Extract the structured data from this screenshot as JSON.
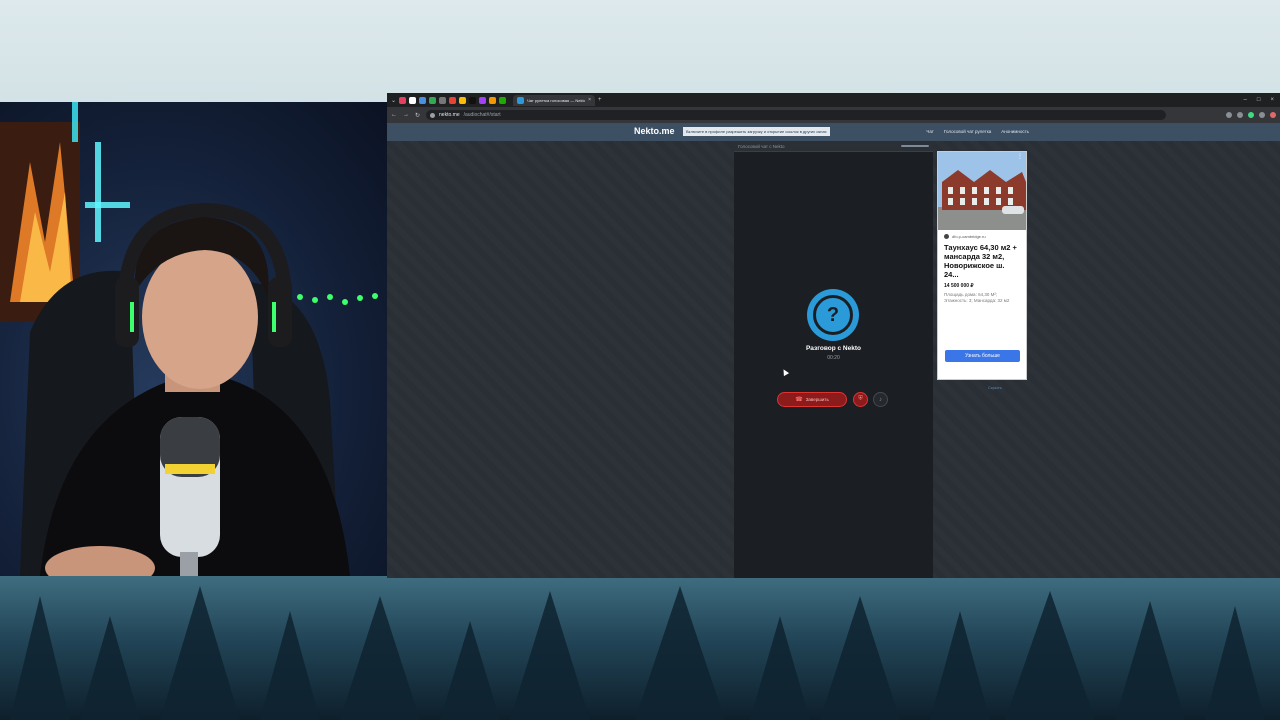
{
  "browser": {
    "tab_title": "Чат рулетка голосовая — Nekto.me",
    "url_host": "nekto.me",
    "url_path": "/audiochat#/start"
  },
  "site": {
    "logo": "Nekto.me",
    "notice": "Включите в профиле разрешить загрузку и открытие ссылок в других окнах",
    "nav": [
      "Чат",
      "Голосовой чат рулетка",
      "Анонимность"
    ]
  },
  "chat": {
    "panel_title": "Голосовой чат с Nekto",
    "avatar_symbol": "?",
    "conversation_label": "Разговор с Nekto",
    "timer": "00:20",
    "end_button": "Завершить",
    "report_icon": "shield-icon",
    "mute_icon": "mic-icon"
  },
  "ad": {
    "source": "dfo.p-cambridge.ru",
    "title": "Таунхаус 64,30 м2 + мансарда 32 м2, Новорижское ш. 24...",
    "price": "14 500 000 ₽",
    "description": "Площадь дома: 64,30 М²; Этажность: 3; Мансарда: 32 м2",
    "button": "Узнать больше",
    "below_link": "Скрыть"
  },
  "colors": {
    "accent": "#2a9ad8",
    "header": "#3d4f63",
    "end_call": "#8c1c1c",
    "ad_button": "#3b76e8"
  }
}
